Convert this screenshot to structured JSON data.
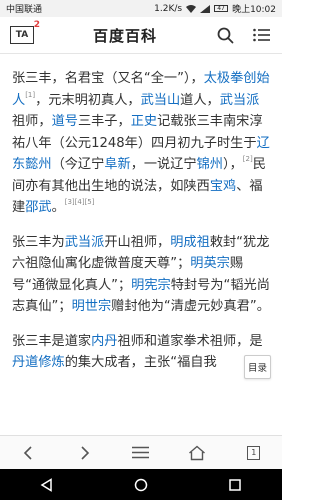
{
  "status_bar": {
    "carrier": "中国联通",
    "speed": "1.2K/s",
    "battery": "47",
    "time": "晚上10:02"
  },
  "header": {
    "tab_label": "TA",
    "tab_badge": "2",
    "title": "百度百科"
  },
  "paragraph1": {
    "t1": "张三丰，名君宝（又名“全一”），",
    "l1": "太极拳创始人",
    "r1": "[1]",
    "t2": "，元末明初真人，",
    "l2": "武当山",
    "t3": "道人，",
    "l3": "武当派",
    "t4": "祖师，",
    "l4": "道号",
    "t5": "三丰子，",
    "l5": "正史",
    "t6": "记载张三丰南宋淳祐八年（公元1248年）四月初九子时生于",
    "l6": "辽东懿州",
    "t7": "（今辽宁",
    "l7": "阜新",
    "t8": "，一说辽宁",
    "l8": "锦州",
    "t9": "），",
    "r2": "[2]",
    "t10": "民间亦有其他出生地的说法，如陕西",
    "l9": "宝鸡",
    "t11": "、福建",
    "l10": "邵武",
    "t12": "。",
    "r3": "[3][4][5]"
  },
  "paragraph2": {
    "t1": "张三丰为",
    "l1": "武当派",
    "t2": "开山祖师，",
    "l2": "明成祖",
    "t3": "敕封“犹龙六祖隐仙寓化虚微普度天尊”；",
    "l3": "明英宗",
    "t4": "赐号“通微显化真人”；",
    "l4": "明宪宗",
    "t5": "特封号为“韬光尚志真仙”；",
    "l5": "明世宗",
    "t6": "赠封他为“清虚元妙真君”。"
  },
  "paragraph3": {
    "t1": "张三丰是道家",
    "l1": "内丹",
    "t2": "祖师和道家拳术祖师，是",
    "l2": "丹道修炼",
    "t3": "的集大成者，主张“福自我"
  },
  "toc_button": "目录",
  "browser_bar": {
    "tabs_count": "1"
  }
}
